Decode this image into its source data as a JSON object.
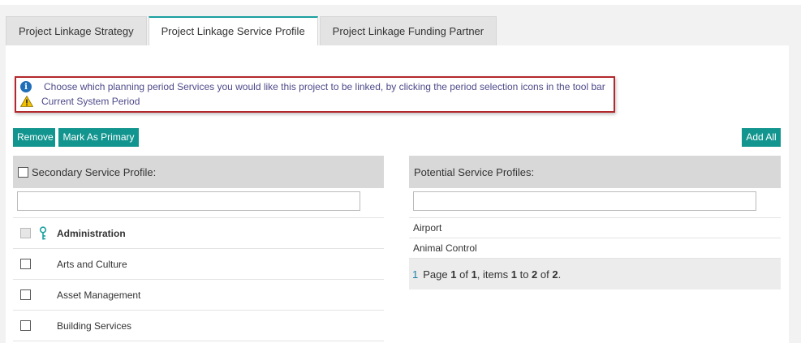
{
  "tabs": [
    {
      "label": "Project Linkage Strategy",
      "active": false
    },
    {
      "label": "Project Linkage Service Profile",
      "active": true
    },
    {
      "label": "Project Linkage Funding Partner",
      "active": false
    }
  ],
  "notice": {
    "info_text": "Choose which planning period Services you would like this project to be linked, by clicking the period selection icons in the tool bar",
    "warning_text": "Current System Period"
  },
  "toolbar": {
    "remove_label": "Remove",
    "mark_primary_label": "Mark As Primary",
    "add_all_label": "Add All"
  },
  "secondary": {
    "header": "Secondary Service Profile:",
    "filter_value": "",
    "items": [
      {
        "label": "Administration",
        "primary": true
      },
      {
        "label": "Arts and Culture",
        "primary": false
      },
      {
        "label": "Asset Management",
        "primary": false
      },
      {
        "label": "Building Services",
        "primary": false
      }
    ]
  },
  "potential": {
    "header": "Potential Service Profiles:",
    "filter_value": "",
    "items": [
      "Airport",
      "Animal Control"
    ],
    "pager": {
      "current_page": "1",
      "page_word": "Page",
      "page": "1",
      "of_word": "of",
      "pages": "1",
      "items_word": ", items",
      "from": "1",
      "to_word": "to",
      "to": "2",
      "of_word2": "of",
      "total": "2",
      "end": "."
    }
  },
  "colors": {
    "accent": "#12958f",
    "notice_border": "#b3282d",
    "tab_active_border": "#1a9fa0"
  }
}
